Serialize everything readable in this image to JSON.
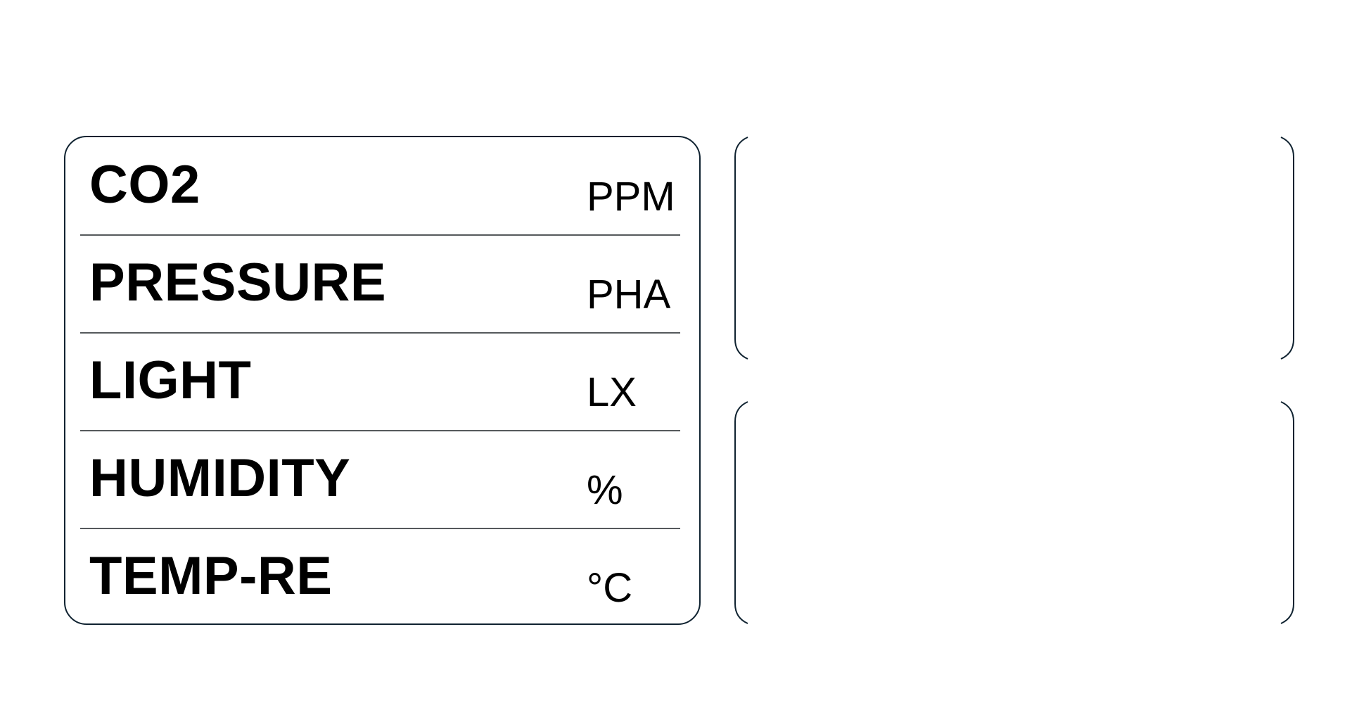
{
  "sensors": [
    {
      "label": "CO2",
      "unit": "PPM"
    },
    {
      "label": "PRESSURE",
      "unit": "PHA"
    },
    {
      "label": "LIGHT",
      "unit": "LX"
    },
    {
      "label": "HUMIDITY",
      "unit": "%"
    },
    {
      "label": "TEMP-RE",
      "unit": "°C"
    }
  ],
  "colors": {
    "border": "#0f2230",
    "divider": "#55595c",
    "text": "#000000",
    "background": "#ffffff"
  }
}
